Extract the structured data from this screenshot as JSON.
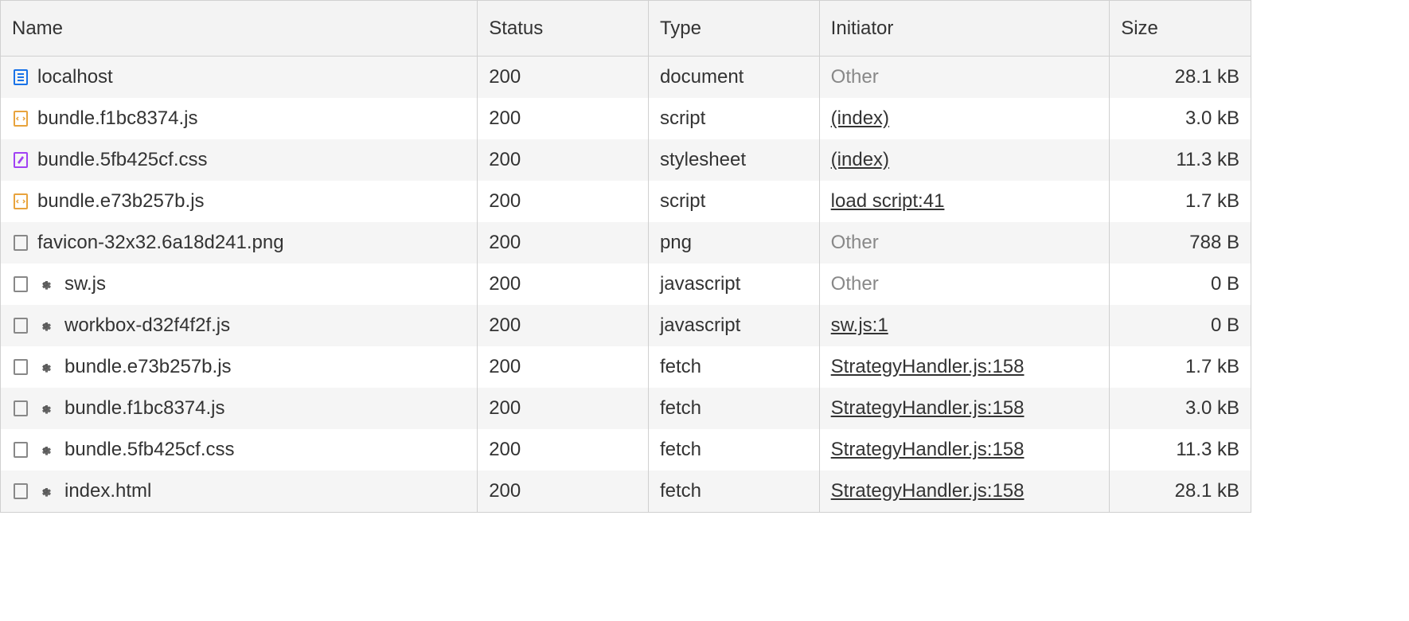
{
  "columns": {
    "name": "Name",
    "status": "Status",
    "type": "Type",
    "initiator": "Initiator",
    "size": "Size"
  },
  "rows": [
    {
      "icon": "document",
      "gear": false,
      "name": "localhost",
      "status": "200",
      "type": "document",
      "initiator": "Other",
      "initiatorLink": false,
      "size": "28.1 kB"
    },
    {
      "icon": "script",
      "gear": false,
      "name": "bundle.f1bc8374.js",
      "status": "200",
      "type": "script",
      "initiator": "(index)",
      "initiatorLink": true,
      "size": "3.0 kB"
    },
    {
      "icon": "stylesheet",
      "gear": false,
      "name": "bundle.5fb425cf.css",
      "status": "200",
      "type": "stylesheet",
      "initiator": "(index)",
      "initiatorLink": true,
      "size": "11.3 kB"
    },
    {
      "icon": "script",
      "gear": false,
      "name": "bundle.e73b257b.js",
      "status": "200",
      "type": "script",
      "initiator": "load script:41",
      "initiatorLink": true,
      "size": "1.7 kB"
    },
    {
      "icon": "file",
      "gear": false,
      "name": "favicon-32x32.6a18d241.png",
      "status": "200",
      "type": "png",
      "initiator": "Other",
      "initiatorLink": false,
      "size": "788 B"
    },
    {
      "icon": "file",
      "gear": true,
      "name": "sw.js",
      "status": "200",
      "type": "javascript",
      "initiator": "Other",
      "initiatorLink": false,
      "size": "0 B"
    },
    {
      "icon": "file",
      "gear": true,
      "name": "workbox-d32f4f2f.js",
      "status": "200",
      "type": "javascript",
      "initiator": "sw.js:1",
      "initiatorLink": true,
      "size": "0 B"
    },
    {
      "icon": "file",
      "gear": true,
      "name": "bundle.e73b257b.js",
      "status": "200",
      "type": "fetch",
      "initiator": "StrategyHandler.js:158",
      "initiatorLink": true,
      "size": "1.7 kB"
    },
    {
      "icon": "file",
      "gear": true,
      "name": "bundle.f1bc8374.js",
      "status": "200",
      "type": "fetch",
      "initiator": "StrategyHandler.js:158",
      "initiatorLink": true,
      "size": "3.0 kB"
    },
    {
      "icon": "file",
      "gear": true,
      "name": "bundle.5fb425cf.css",
      "status": "200",
      "type": "fetch",
      "initiator": "StrategyHandler.js:158",
      "initiatorLink": true,
      "size": "11.3 kB"
    },
    {
      "icon": "file",
      "gear": true,
      "name": "index.html",
      "status": "200",
      "type": "fetch",
      "initiator": "StrategyHandler.js:158",
      "initiatorLink": true,
      "size": "28.1 kB"
    }
  ]
}
